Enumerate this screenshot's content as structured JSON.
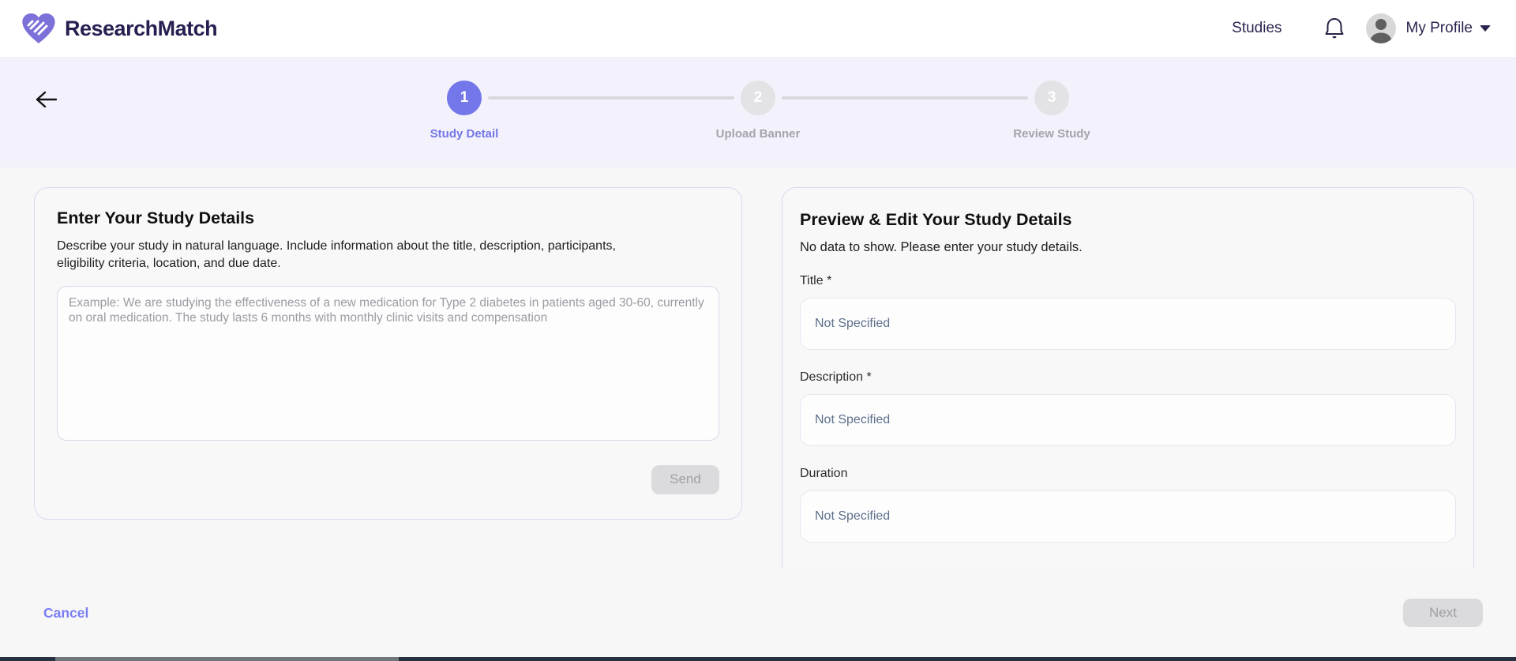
{
  "header": {
    "brand": "ResearchMatch",
    "nav": {
      "studies": "Studies",
      "profile": "My Profile"
    }
  },
  "stepper": {
    "steps": [
      {
        "number": "1",
        "label": "Study Detail",
        "state": "active"
      },
      {
        "number": "2",
        "label": "Upload Banner",
        "state": "inactive"
      },
      {
        "number": "3",
        "label": "Review Study",
        "state": "inactive"
      }
    ]
  },
  "left_card": {
    "title": "Enter Your Study Details",
    "description": "Describe your study in natural language. Include information about the title, description, participants, eligibility criteria, location, and due date.",
    "textarea_placeholder": "Example: We are studying the effectiveness of a new medication for Type 2 diabetes in patients aged 30-60, currently on oral medication. The study lasts 6 months with monthly clinic visits and compensation",
    "textarea_value": "",
    "send_label": "Send"
  },
  "right_card": {
    "title": "Preview & Edit Your Study Details",
    "empty_message": "No data to show. Please enter your study details.",
    "fields": [
      {
        "label": "Title *",
        "value": "Not Specified"
      },
      {
        "label": "Description *",
        "value": "Not Specified"
      },
      {
        "label": "Duration",
        "value": "Not Specified"
      }
    ]
  },
  "footer": {
    "cancel_label": "Cancel",
    "next_label": "Next"
  },
  "colors": {
    "accent": "#7377e9",
    "brand_text": "#262052",
    "stepper_bg": "#f3f1fb",
    "page_bg": "#f7f7f8",
    "card_border": "#dcd8f0",
    "field_value_text": "#5e708a",
    "disabled_bg": "#dbdbdd",
    "disabled_text": "#9fa0a5",
    "inactive_step": "#e3e3e6",
    "bottom_bar": "#27313f"
  }
}
